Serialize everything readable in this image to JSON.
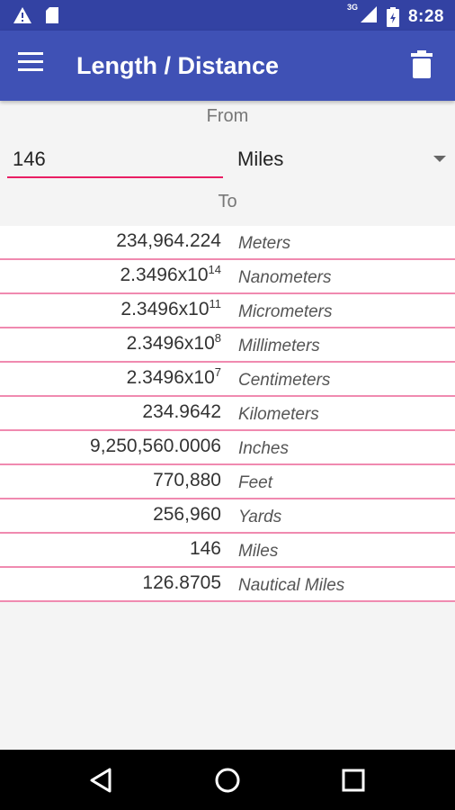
{
  "status_bar": {
    "time": "8:28",
    "network_label": "3G",
    "icons": [
      "warning-icon",
      "sd-card-icon",
      "signal-icon",
      "battery-icon"
    ]
  },
  "app_bar": {
    "title": "Length / Distance",
    "menu_icon": "hamburger-menu-icon",
    "action_icon": "trash-icon"
  },
  "converter": {
    "from_label": "From",
    "to_label": "To",
    "input_value": "146",
    "selected_unit": "Miles"
  },
  "results": [
    {
      "mantissa": "234,964.224",
      "exponent": "",
      "unit": "Meters"
    },
    {
      "mantissa": "2.3496x10",
      "exponent": "14",
      "unit": "Nanometers"
    },
    {
      "mantissa": "2.3496x10",
      "exponent": "11",
      "unit": "Micrometers"
    },
    {
      "mantissa": "2.3496x10",
      "exponent": "8",
      "unit": "Millimeters"
    },
    {
      "mantissa": "2.3496x10",
      "exponent": "7",
      "unit": "Centimeters"
    },
    {
      "mantissa": "234.9642",
      "exponent": "",
      "unit": "Kilometers"
    },
    {
      "mantissa": "9,250,560.0006",
      "exponent": "",
      "unit": "Inches"
    },
    {
      "mantissa": "770,880",
      "exponent": "",
      "unit": "Feet"
    },
    {
      "mantissa": "256,960",
      "exponent": "",
      "unit": "Yards"
    },
    {
      "mantissa": "146",
      "exponent": "",
      "unit": "Miles"
    },
    {
      "mantissa": "126.8705",
      "exponent": "",
      "unit": "Nautical Miles"
    }
  ],
  "colors": {
    "primary": "#3f51b5",
    "status_bar": "#3342a3",
    "accent": "#e91e63",
    "divider": "#f08ab0"
  }
}
